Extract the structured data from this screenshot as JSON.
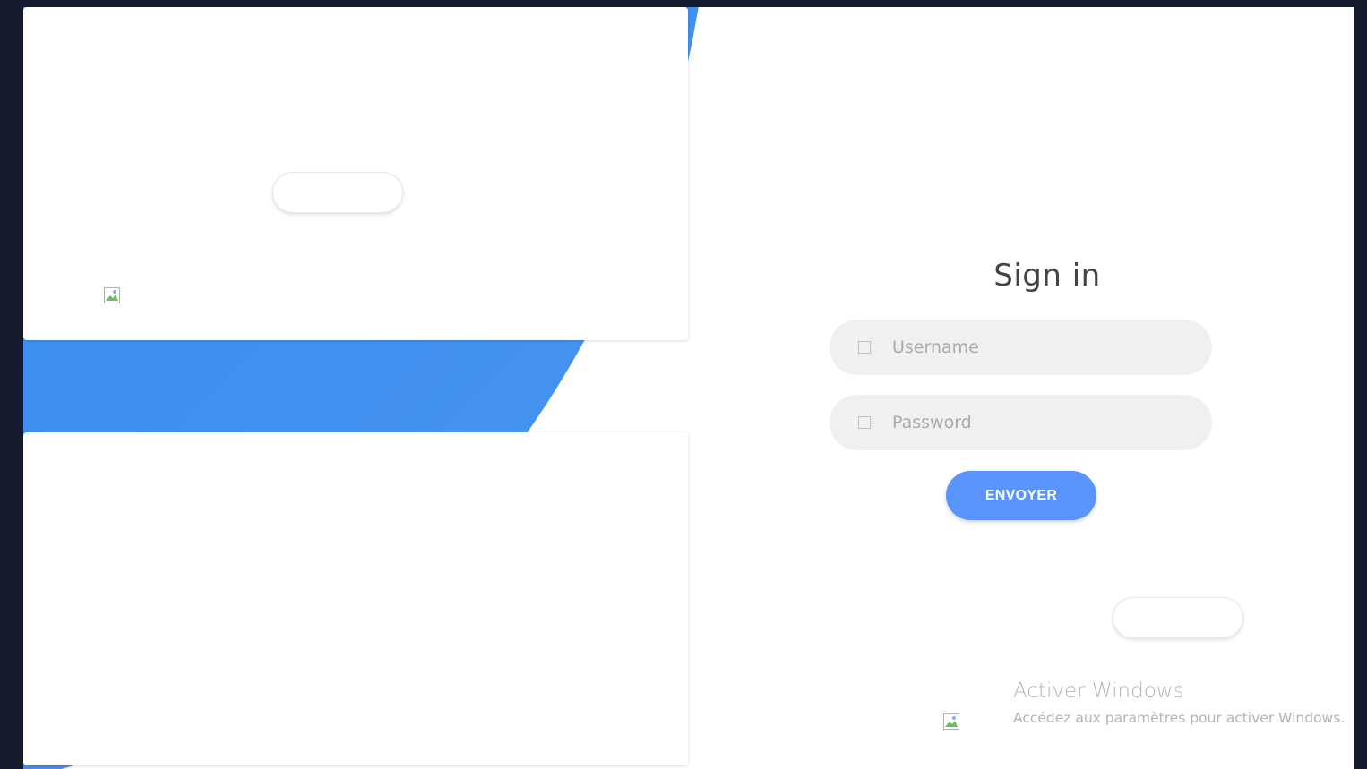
{
  "sign_in": {
    "title": "Sign in",
    "username_placeholder": "Username",
    "password_placeholder": "Password",
    "submit_label": "ENVOYER"
  },
  "icons": {
    "username": "user-icon",
    "password": "lock-icon",
    "broken_image": "broken-image-icon"
  },
  "watermark": {
    "title": "Activer Windows",
    "subtitle": "Accédez aux paramètres pour activer Windows."
  },
  "colors": {
    "accent": "#5995fd",
    "blob": "#3b8cee",
    "input_bg": "#f0f0f0",
    "background": "#141a2b"
  }
}
